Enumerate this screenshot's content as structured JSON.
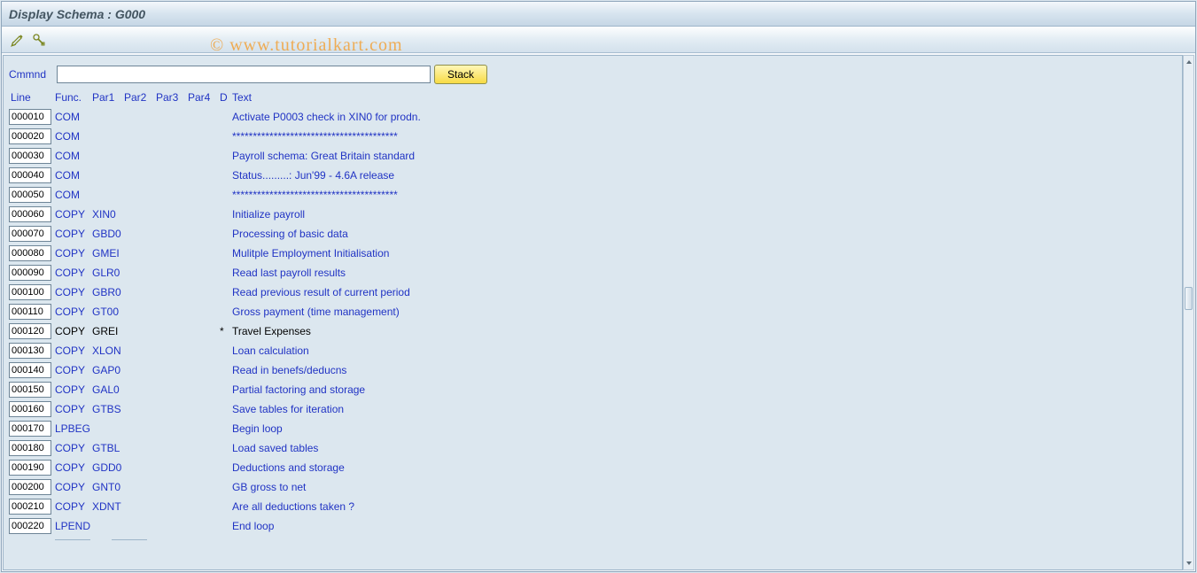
{
  "title": "Display Schema : G000",
  "watermark": "© www.tutorialkart.com",
  "toolbar": {
    "icon1": "pencil-wrench-icon",
    "icon2": "key-icon"
  },
  "command": {
    "label": "Cmmnd",
    "value": "",
    "stack_label": "Stack"
  },
  "headers": {
    "line": "Line",
    "func": "Func.",
    "par1": "Par1",
    "par2": "Par2",
    "par3": "Par3",
    "par4": "Par4",
    "d": "D",
    "text": "Text"
  },
  "rows": [
    {
      "line": "000010",
      "func": "COM",
      "par1": "",
      "d": "",
      "text": "Activate P0003 check in XIN0 for prodn."
    },
    {
      "line": "000020",
      "func": "COM",
      "par1": "",
      "d": "",
      "text": "****************************************"
    },
    {
      "line": "000030",
      "func": "COM",
      "par1": "",
      "d": "",
      "text": "Payroll schema: Great Britain standard"
    },
    {
      "line": "000040",
      "func": "COM",
      "par1": "",
      "d": "",
      "text": "Status.........: Jun'99 - 4.6A release"
    },
    {
      "line": "000050",
      "func": "COM",
      "par1": "",
      "d": "",
      "text": "****************************************"
    },
    {
      "line": "000060",
      "func": "COPY",
      "par1": "XIN0",
      "d": "",
      "text": "Initialize payroll"
    },
    {
      "line": "000070",
      "func": "COPY",
      "par1": "GBD0",
      "d": "",
      "text": "Processing of basic data"
    },
    {
      "line": "000080",
      "func": "COPY",
      "par1": "GMEI",
      "d": "",
      "text": "Mulitple Employment Initialisation"
    },
    {
      "line": "000090",
      "func": "COPY",
      "par1": "GLR0",
      "d": "",
      "text": "Read last payroll results"
    },
    {
      "line": "000100",
      "func": "COPY",
      "par1": "GBR0",
      "d": "",
      "text": "Read previous result of current period"
    },
    {
      "line": "000110",
      "func": "COPY",
      "par1": "GT00",
      "d": "",
      "text": "Gross payment (time management)"
    },
    {
      "line": "000120",
      "func": "COPY",
      "par1": "GREI",
      "d": "*",
      "text": "Travel Expenses"
    },
    {
      "line": "000130",
      "func": "COPY",
      "par1": "XLON",
      "d": "",
      "text": "Loan calculation"
    },
    {
      "line": "000140",
      "func": "COPY",
      "par1": "GAP0",
      "d": "",
      "text": "Read in benefs/deducns"
    },
    {
      "line": "000150",
      "func": "COPY",
      "par1": "GAL0",
      "d": "",
      "text": "Partial factoring and storage"
    },
    {
      "line": "000160",
      "func": "COPY",
      "par1": "GTBS",
      "d": "",
      "text": "Save tables for iteration"
    },
    {
      "line": "000170",
      "func": "LPBEG",
      "par1": "",
      "d": "",
      "text": "Begin loop"
    },
    {
      "line": "000180",
      "func": "COPY",
      "par1": "GTBL",
      "d": "",
      "text": "Load saved tables"
    },
    {
      "line": "000190",
      "func": "COPY",
      "par1": "GDD0",
      "d": "",
      "text": "Deductions and storage"
    },
    {
      "line": "000200",
      "func": "COPY",
      "par1": "GNT0",
      "d": "",
      "text": "GB gross to net"
    },
    {
      "line": "000210",
      "func": "COPY",
      "par1": "XDNT",
      "d": "",
      "text": "Are all deductions taken ?"
    },
    {
      "line": "000220",
      "func": "LPEND",
      "par1": "",
      "d": "",
      "text": "End loop"
    }
  ]
}
